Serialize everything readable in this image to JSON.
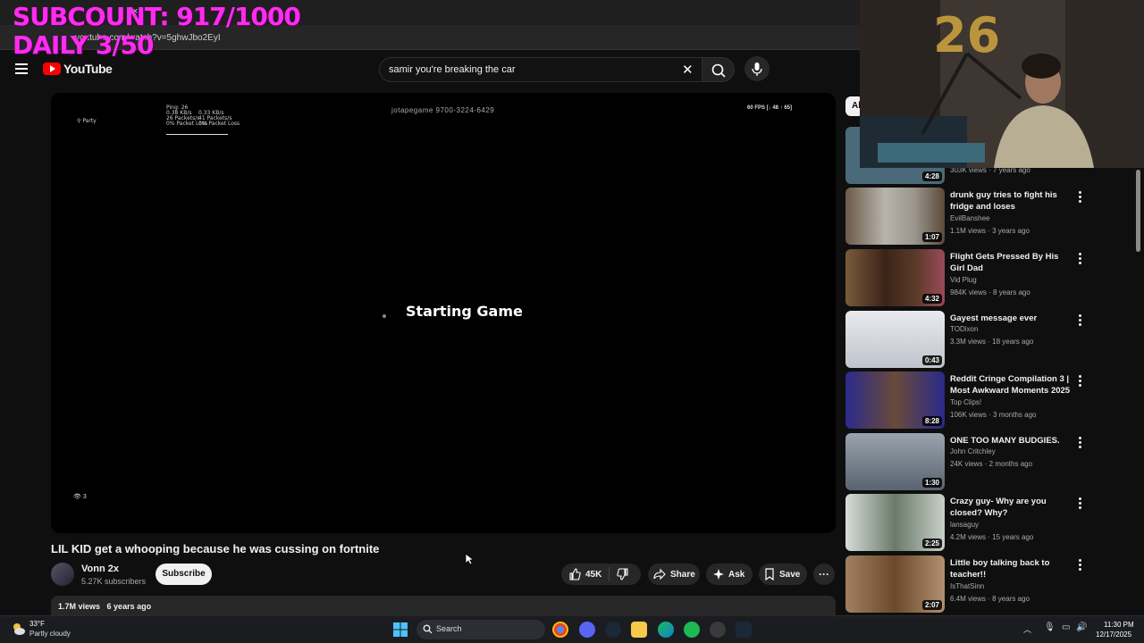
{
  "overlay": {
    "subcount": "SUBCOUNT: 917/1000",
    "daily": "DAILY 3/50"
  },
  "browser": {
    "url": "youtube.com/watch?v=5ghwJbo2EyI",
    "tab_close": "×"
  },
  "header": {
    "logo": "YouTube",
    "search_value": "samir you're breaking the car",
    "clear": "✕"
  },
  "player": {
    "hud_party": "Party",
    "hud_ping": "Ping: 26",
    "hud_stats_a": "0.38 KB/s",
    "hud_stats_b": "0.33 KB/s",
    "hud_packets_a": "26 Packets/s",
    "hud_packets_b": "41 Packets/s",
    "hud_loss_a": "0% Packet Loss",
    "hud_loss_b": "0% Packet Loss",
    "code": "jotapegame   9700-3224-6429",
    "fps": "60 FPS [↓ 48 ↑ 65]",
    "status": "Starting Game",
    "viewers": "3"
  },
  "video": {
    "title": "LIL KID get a whooping because he was cussing on fortnite",
    "channel": "Vonn 2x",
    "subscribers": "5.27K subscribers",
    "subscribe": "Subscribe",
    "likes": "45K",
    "share": "Share",
    "ask": "Ask",
    "save": "Save",
    "more": "···",
    "views": "1.7M views",
    "age": "6 years ago"
  },
  "sidebar": {
    "chip": "Al",
    "items": [
      {
        "title": "",
        "channel": "",
        "meta": "303K views · 7 years ago",
        "duration": "4:28",
        "thumb": "#4a6a7a"
      },
      {
        "title": "drunk guy tries to fight his fridge and loses",
        "channel": "EvilBanshee",
        "meta": "1.1M views · 3 years ago",
        "duration": "1:07",
        "thumb": "#8a7a6a"
      },
      {
        "title": "Flight Gets Pressed By His Girl Dad",
        "channel": "Vid Plug",
        "meta": "984K views · 8 years ago",
        "duration": "4:32",
        "thumb": "#6a4a3a"
      },
      {
        "title": "Gayest message ever",
        "channel": "TODixon",
        "meta": "3.3M views · 18 years ago",
        "duration": "0:43",
        "thumb": "#c8ccd4"
      },
      {
        "title": "Reddit Cringe Compilation 3 | Most Awkward Moments 2025",
        "channel": "Top Clips!",
        "meta": "106K views · 3 months ago",
        "duration": "8:28",
        "thumb": "#3a3aa0"
      },
      {
        "title": "ONE TOO MANY BUDGIES.",
        "channel": "John Critchley",
        "meta": "24K views · 2 months ago",
        "duration": "1:30",
        "thumb": "#7a8a9a"
      },
      {
        "title": "Crazy guy- Why are you closed? Why?",
        "channel": "lansaguy",
        "meta": "4.2M views · 15 years ago",
        "duration": "2:25",
        "thumb": "#8a9a8a"
      },
      {
        "title": "Little boy talking back to teacher!!",
        "channel": "IsThatSinn",
        "meta": "6.4M views · 8 years ago",
        "duration": "2:07",
        "thumb": "#8a6a4a"
      }
    ]
  },
  "taskbar": {
    "temp": "33°F",
    "weather": "Partly cloudy",
    "search": "Search",
    "time": "11:30 PM",
    "date": "12/17/2025"
  }
}
